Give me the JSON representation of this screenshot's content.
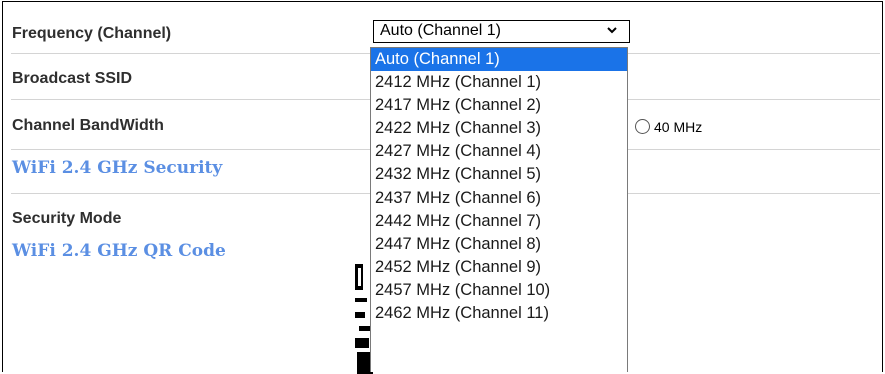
{
  "form": {
    "frequency_label": "Frequency (Channel)",
    "frequency_value": "Auto (Channel 1)",
    "broadcast_ssid_label": "Broadcast SSID",
    "channel_bandwidth_label": "Channel BandWidth",
    "bandwidth_option_40": "40 MHz",
    "security_section": "WiFi 2.4 GHz Security",
    "security_mode_label": "Security Mode",
    "qr_section": "WiFi 2.4 GHz QR Code"
  },
  "dropdown": {
    "options": [
      "Auto (Channel 1)",
      "2412 MHz (Channel 1)",
      "2417 MHz (Channel 2)",
      "2422 MHz (Channel 3)",
      "2427 MHz (Channel 4)",
      "2432 MHz (Channel 5)",
      "2437 MHz (Channel 6)",
      "2442 MHz (Channel 7)",
      "2447 MHz (Channel 8)",
      "2452 MHz (Channel 9)",
      "2457 MHz (Channel 10)",
      "2462 MHz (Channel 11)"
    ],
    "selected_index": 0
  },
  "colors": {
    "section_title": "#5b8fe3",
    "selected_option": "#1a73e8"
  },
  "icons": {
    "select_arrow": "chevron-down-icon",
    "radio": "radio-icon"
  }
}
